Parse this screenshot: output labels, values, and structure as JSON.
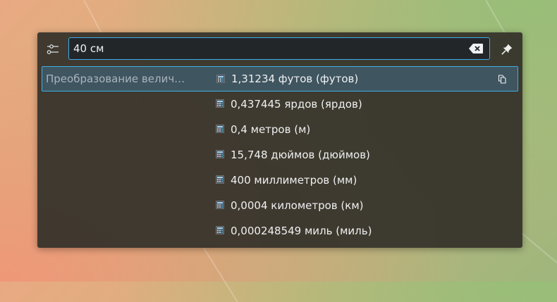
{
  "search": {
    "query": "40 см"
  },
  "icons": {
    "config": "configure-icon",
    "clear": "edit-clear-icon",
    "pin": "pin-icon",
    "result": "calculator-icon",
    "copy": "copy-icon"
  },
  "colors": {
    "accent": "#3daee9",
    "panel": "#35322b",
    "text": "#eff0f1",
    "category_text": "#a9b4bd",
    "selection": "#3f5560"
  },
  "results": {
    "category": "Преобразование велич…",
    "items": [
      {
        "label": "1,31234 футов (футов)"
      },
      {
        "label": "0,437445 ярдов (ярдов)"
      },
      {
        "label": "0,4 метров (м)"
      },
      {
        "label": "15,748 дюймов (дюймов)"
      },
      {
        "label": "400 миллиметров (мм)"
      },
      {
        "label": "0,0004 километров (км)"
      },
      {
        "label": "0,000248549 миль (миль)"
      }
    ]
  }
}
